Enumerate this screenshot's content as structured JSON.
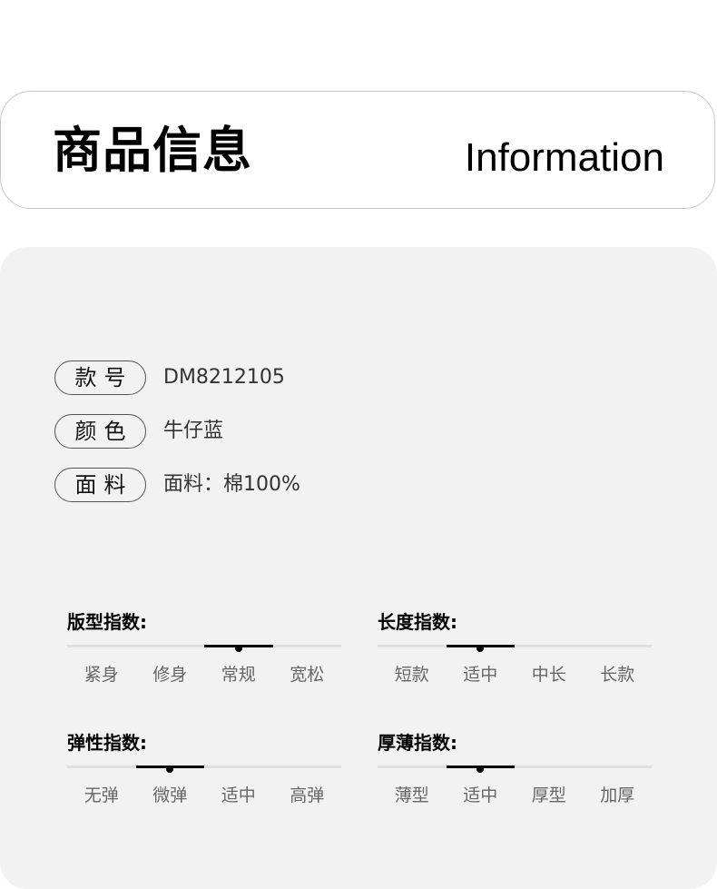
{
  "header": {
    "title_cn": "商品信息",
    "title_en": "Information"
  },
  "specs": [
    {
      "label": "款号",
      "value": "DM8212105"
    },
    {
      "label": "颜色",
      "value": "牛仔蓝"
    },
    {
      "label": "面料",
      "value": "面料：棉100%"
    }
  ],
  "indices": [
    {
      "title": "版型指数:",
      "options": [
        "紧身",
        "修身",
        "常规",
        "宽松"
      ],
      "selected_index": 2
    },
    {
      "title": "长度指数:",
      "options": [
        "短款",
        "适中",
        "中长",
        "长款"
      ],
      "selected_index": 1
    },
    {
      "title": "弹性指数:",
      "options": [
        "无弹",
        "微弹",
        "适中",
        "高弹"
      ],
      "selected_index": 1
    },
    {
      "title": "厚薄指数:",
      "options": [
        "薄型",
        "适中",
        "厚型",
        "加厚"
      ],
      "selected_index": 1
    }
  ],
  "colors": {
    "panel_background": "#f2f2f2",
    "track": "#e0e0e0",
    "active": "#000000",
    "option_text": "#666666"
  }
}
